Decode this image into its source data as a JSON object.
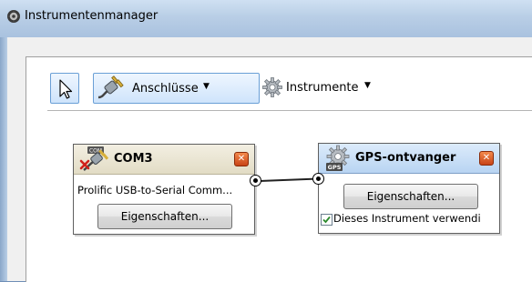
{
  "window": {
    "title": "Instrumentenmanager",
    "icon": "instrument-manager-icon"
  },
  "toolbar": {
    "select_tool_icon": "pointer-arrow-icon",
    "connections_label": "Anschlüsse",
    "connections_icon": "usb-plug-icon",
    "instruments_label": "Instrumente",
    "instruments_icon": "gear-icon",
    "dropdown_icon": "caret-down-icon"
  },
  "nodes": [
    {
      "title": "COM3",
      "icon": "com-port-disconnected-icon",
      "description": "Prolific USB-to-Serial Comm...",
      "button_label": "Eigenschaften...",
      "close_label": "✕"
    },
    {
      "title": "GPS-ontvanger",
      "icon": "gps-gear-icon",
      "button_label": "Eigenschaften...",
      "checkbox_label": "Dieses Instrument verwendi",
      "checkbox_checked": true,
      "close_label": "✕"
    }
  ],
  "colors": {
    "title_bar": "#b9cee6",
    "toolbar_active": "#cfe4fb",
    "node1_header": "#e2dcc5",
    "node2_header": "#b8d4f2",
    "close_button": "#d9581f"
  }
}
